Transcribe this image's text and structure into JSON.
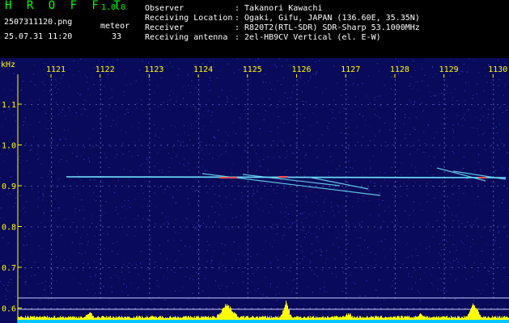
{
  "header": {
    "app_name": "H R O F F T",
    "version": "1.0.0",
    "filename": "2507311120.png",
    "meteor_label": "meteor",
    "datetime": "25.07.31 11:20",
    "meteor_count": "33",
    "fields": [
      {
        "label": "Observer",
        "value": ": Takanori Kawachi"
      },
      {
        "label": "Receiving Location",
        "value": ": Ogaki, Gifu, JAPAN (136.60E, 35.35N)"
      },
      {
        "label": "Receiver",
        "value": ": R820T2(RTL-SDR) SDR-Sharp 53.1000MHz"
      },
      {
        "label": "Receiving antenna",
        "value": ": 2el-HB9CV Vertical (el. E-W)"
      }
    ]
  },
  "spectrogram": {
    "y_unit": "kHz",
    "x_ticks": [
      "1121",
      "1122",
      "1123",
      "1124",
      "1125",
      "1126",
      "1127",
      "1128",
      "1129",
      "1130"
    ],
    "y_ticks": [
      "1.1",
      "1.0",
      "0.9",
      "0.8",
      "0.7",
      "0.6"
    ],
    "colors": {
      "background": "#0a0a5a",
      "carrier": "#6fe3ff",
      "echo": "#ff5050",
      "signal_bar": "#ffff00",
      "noise_floor": "#00c8ff"
    }
  }
}
